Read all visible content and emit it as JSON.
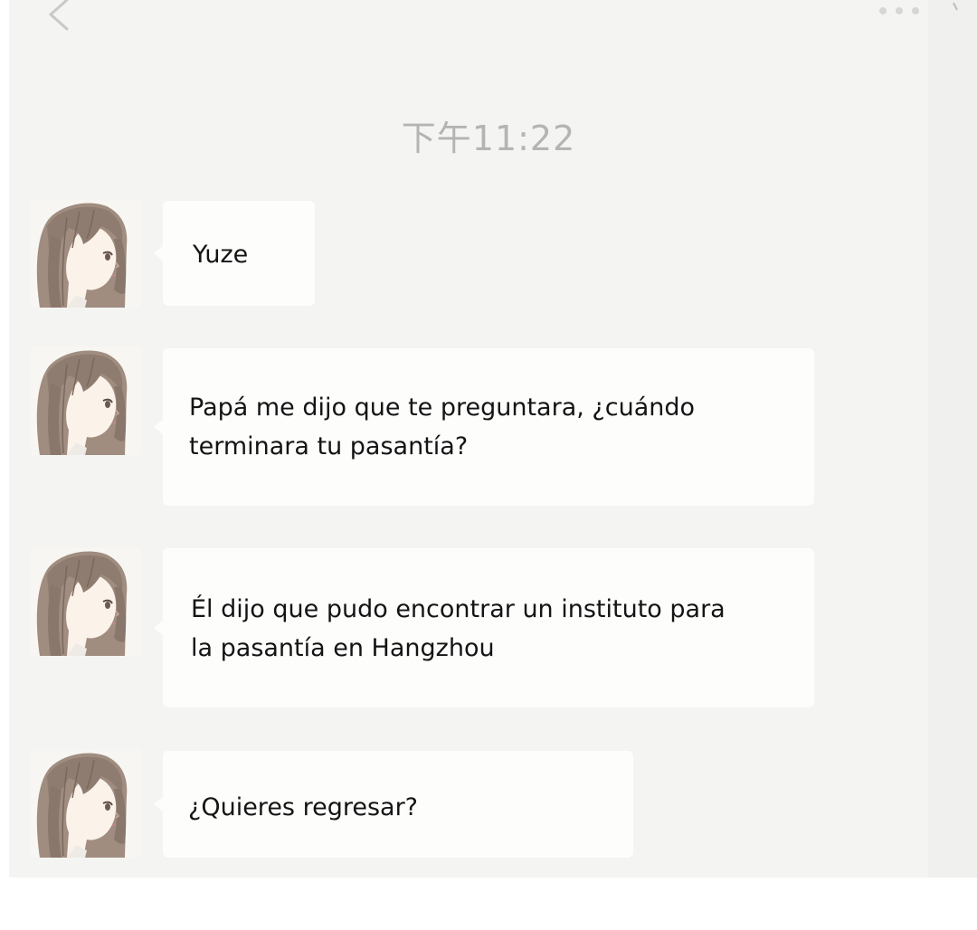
{
  "header": {
    "back_icon": "chevron-left-icon",
    "more_icon": "more-dots-icon"
  },
  "chat": {
    "timestamp": "下午11:22",
    "messages": [
      {
        "sender": "incoming",
        "avatar_icon": "anime-girl-avatar",
        "text": "Yuze"
      },
      {
        "sender": "incoming",
        "avatar_icon": "anime-girl-avatar",
        "text": "Papá me dijo que te preguntara, ¿cuándo\nterminara tu pasantía?"
      },
      {
        "sender": "incoming",
        "avatar_icon": "anime-girl-avatar",
        "text": "Él dijo que pudo encontrar un instituto para\nla pasantía en Hangzhou"
      },
      {
        "sender": "incoming",
        "avatar_icon": "anime-girl-avatar",
        "text": "¿Quieres regresar?"
      }
    ]
  },
  "colors": {
    "chat_background": "#f4f4f3",
    "bubble_background": "#fdfdfc",
    "timestamp_text": "#b4b4b4",
    "message_text": "#141414",
    "avatar_hair": "#9a877a"
  }
}
